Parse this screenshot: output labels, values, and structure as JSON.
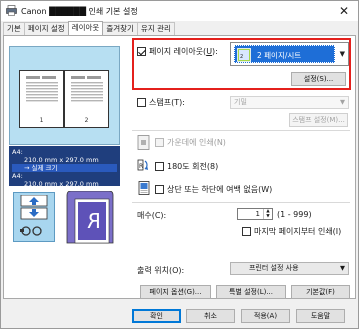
{
  "window": {
    "title": "Canon ██████ 인쇄 기본 설정",
    "close_glyph": "✕"
  },
  "tabs": [
    {
      "label": "기본"
    },
    {
      "label": "페이지 설정"
    },
    {
      "label": "레이아웃"
    },
    {
      "label": "즐겨찾기"
    },
    {
      "label": "유지 관리"
    }
  ],
  "preview": {
    "page_left_number": "1",
    "page_right_number": "2",
    "paper_line1": "A4:",
    "paper_line2": "210.0 mm x 297.0 mm",
    "paper_line3": "→ 실제 크기",
    "paper_line4": "A4:",
    "paper_line5": "210.0 mm x 297.0 mm",
    "reverse_letter": "R",
    "colors": {
      "preview_bg": "#b7dff2",
      "size_bg": "#1f3e7d"
    }
  },
  "layout": {
    "checkbox_label": "페이지 레이아웃(",
    "checkbox_mnemonic": "U",
    "checkbox_suffix": "):",
    "checked": true,
    "select_value": "2 페이지/시트",
    "settings_button": "설정(S)...",
    "highlight_color": "#e4201c"
  },
  "stamp": {
    "checkbox_label": "스탬프(T):",
    "combo_value": "기밀",
    "settings_button": "스탬프 설정(M)..."
  },
  "print_center": {
    "label": "가운데에 인쇄(N)"
  },
  "rotate180": {
    "label": "180도 회전(8)"
  },
  "top_bottom_margin": {
    "label": "상단 또는 하단에 여백 없음(W)"
  },
  "copies": {
    "label": "매수(C):",
    "value": "1",
    "range": "(1 - 999)",
    "last_page_first": "마지막 페이지부터 인쇄(I)"
  },
  "output_position": {
    "label": "출력 위치(O):",
    "value": "프린터 설정 사용"
  },
  "buttons": {
    "page_options": "페이지 옵션(G)...",
    "special_settings": "특별 설정(L)...",
    "defaults": "기본값(F)",
    "ok": "확인",
    "cancel": "취소",
    "apply": "적용(A)",
    "help": "도움말"
  }
}
